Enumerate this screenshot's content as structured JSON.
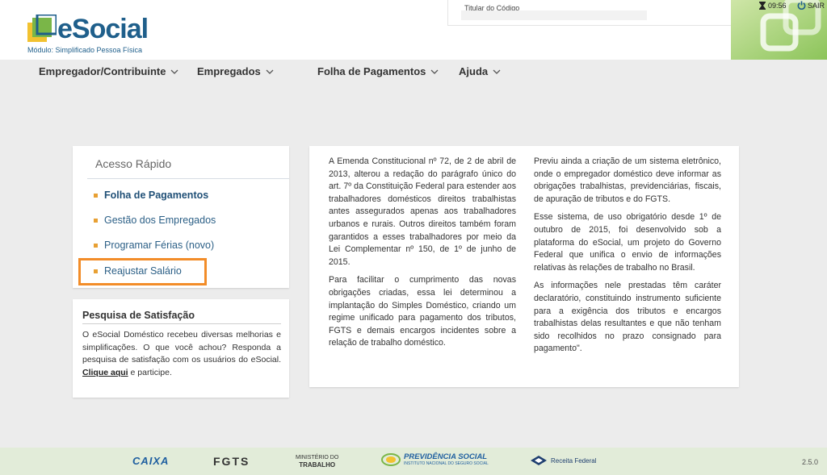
{
  "header": {
    "logo_text": "eSocial",
    "module": "Módulo: Simplificado Pessoa Física",
    "holder_label": "Titular do Código",
    "holder_value": "",
    "time": "09:56",
    "logout_label": "SAIR"
  },
  "nav": {
    "items": [
      {
        "label": "Empregador/Contribuinte"
      },
      {
        "label": "Empregados"
      },
      {
        "label": "Folha de Pagamentos"
      },
      {
        "label": "Ajuda"
      }
    ]
  },
  "quick_access": {
    "title": "Acesso Rápido",
    "items": [
      {
        "label": "Folha de Pagamentos"
      },
      {
        "label": "Gestão dos Empregados"
      },
      {
        "label": "Programar Férias (novo)"
      },
      {
        "label": "Reajustar Salário"
      }
    ]
  },
  "survey": {
    "title": "Pesquisa de Satisfação",
    "text": "O eSocial Doméstico recebeu diversas melhorias e simplificações. O que você achou? Responda a pesquisa de satisfação com os usuários do eSocial.",
    "link_label": "Clique aqui",
    "text_after": "e participe."
  },
  "main": {
    "col1": [
      "A Emenda Constitucional nº 72, de 2 de abril de 2013, alterou a redação do parágrafo único do art. 7º da Constituição Federal para estender aos trabalhadores domésticos direitos trabalhistas antes assegurados apenas aos trabalhadores urbanos e rurais. Outros direitos também foram garantidos a esses trabalhadores por meio da Lei Complementar nº 150, de 1º de junho de 2015.",
      "Para facilitar o cumprimento das novas obrigações criadas, essa lei determinou a implantação do Simples Doméstico, criando um regime unificado para pagamento dos tributos, FGTS e demais encargos incidentes sobre a relação de trabalho doméstico."
    ],
    "col2": [
      "Previu ainda a criação de um sistema eletrônico, onde o empregador doméstico deve informar as obrigações trabalhistas, previdenciárias, fiscais, de apuração de tributos e do FGTS.",
      "Esse sistema, de uso obrigatório desde 1º de outubro de 2015, foi desenvolvido sob a plataforma do eSocial, um projeto do Governo Federal que unifica o envio de informações relativas às relações de trabalho no Brasil.",
      "As informações nele prestadas têm caráter declaratório, constituindo instrumento suficiente para a exigência dos tributos e encargos trabalhistas delas resultantes e que não tenham sido recolhidos no prazo consignado para pagamento\"."
    ]
  },
  "footer": {
    "caixa": "CAIXA",
    "fgts": "FGTS",
    "ministerio_line1": "MINISTÉRIO DO",
    "ministerio_line2": "TRABALHO",
    "previdencia_line1": "PREVIDÊNCIA SOCIAL",
    "previdencia_line2": "INSTITUTO NACIONAL DO SEGURO SOCIAL",
    "receita": "Receita Federal",
    "version": "2.5.0"
  },
  "colors": {
    "brand_blue": "#1f5f8b",
    "accent_orange": "#f28c28",
    "bullet": "#e8a033",
    "footer_bg": "#e2ecd9"
  }
}
